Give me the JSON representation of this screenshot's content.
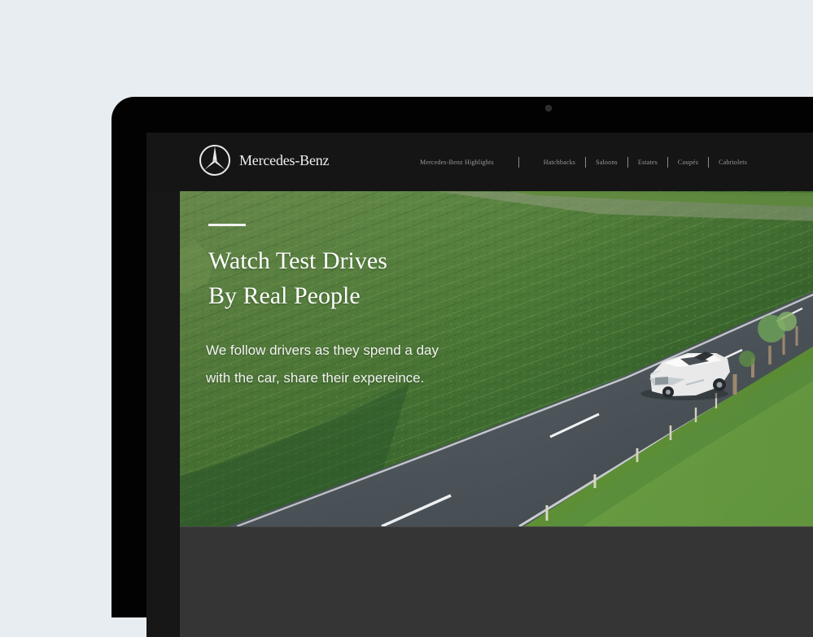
{
  "brand": {
    "name": "Mercedes-Benz",
    "logo_icon": "three-pointed-star-icon"
  },
  "nav": {
    "items": [
      "Mercedes-Benz Highlights",
      "Hatchbacks",
      "Saloons",
      "Estates",
      "Coupés",
      "Cabriolets"
    ]
  },
  "hero": {
    "title_line_1": "Watch Test Drives",
    "title_line_2": "By Real People",
    "description_line_1": "We follow drivers as they spend a day",
    "description_line_2": "with the car, share their expereince."
  },
  "colors": {
    "background": "#e8edf1",
    "device": "#020202",
    "screen": "#171717",
    "panel": "#353535"
  }
}
